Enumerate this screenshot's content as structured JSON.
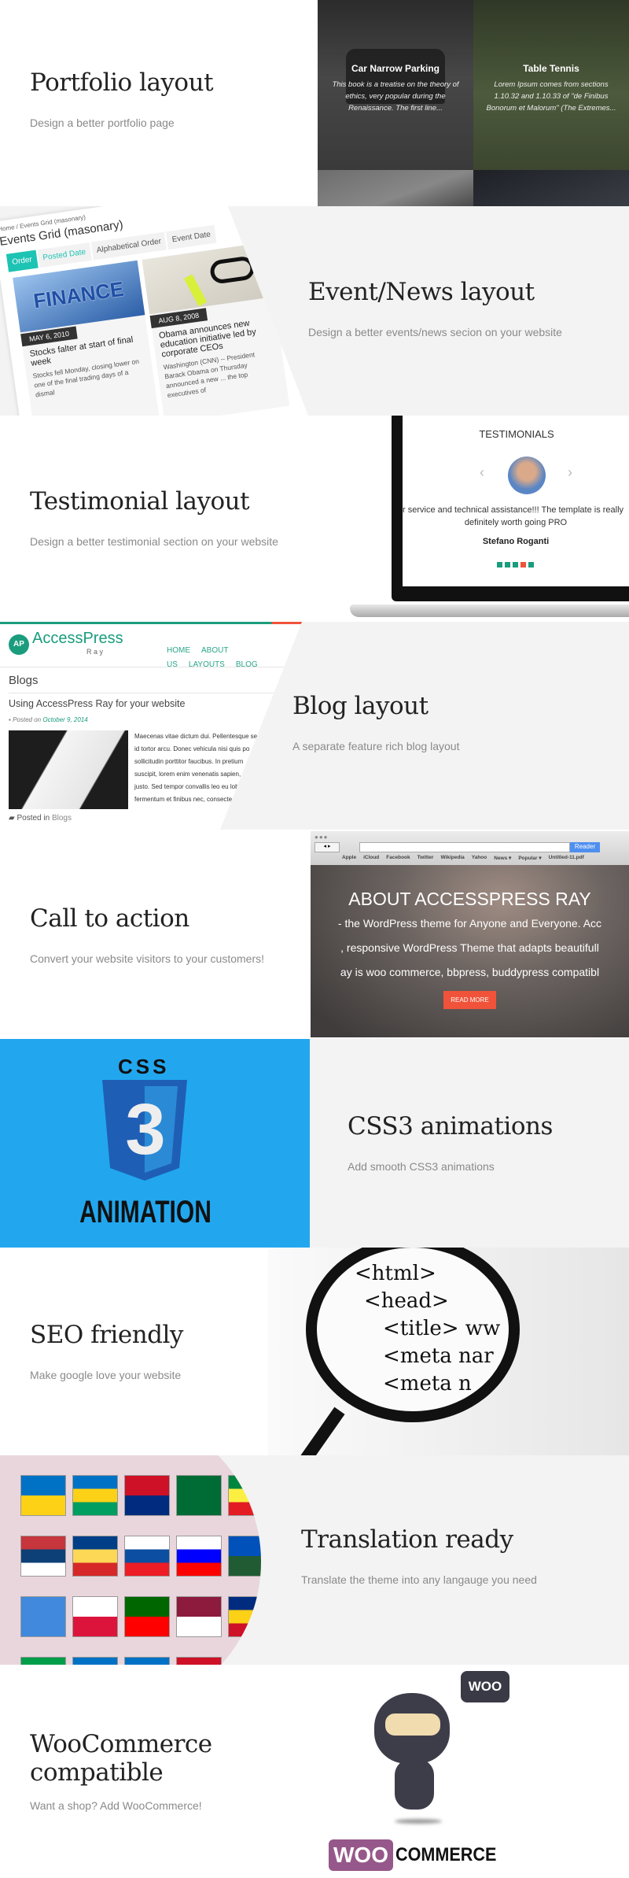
{
  "features": [
    {
      "title": "Portfolio layout",
      "subtitle": "Design a better portfolio page"
    },
    {
      "title": "Event/News layout",
      "subtitle": "Design a better events/news secion on your website"
    },
    {
      "title": "Testimonial layout",
      "subtitle": "Design a better testimonial section on your website"
    },
    {
      "title": "Blog layout",
      "subtitle": "A separate feature rich blog layout"
    },
    {
      "title": "Call to action",
      "subtitle": "Convert your website visitors to your customers!"
    },
    {
      "title": "CSS3 animations",
      "subtitle": "Add smooth CSS3 animations"
    },
    {
      "title": "SEO friendly",
      "subtitle": "Make google love your website"
    },
    {
      "title": "Translation ready",
      "subtitle": "Translate the theme into any langauge you need"
    },
    {
      "title": "WooCommerce compatible",
      "subtitle": "Want a shop? Add WooCommerce!"
    }
  ],
  "portfolio": {
    "items": [
      {
        "title": "Car Narrow Parking",
        "text": "This book is a treatise on the theory of ethics, very popular during the Renaissance. The first line..."
      },
      {
        "title": "Table Tennis",
        "text": "Lorem Ipsum comes from sections 1.10.32 and 1.10.33 of \"de Finibus Bonorum et Malorum\" (The Extremes..."
      }
    ]
  },
  "events": {
    "breadcrumb": "Home / Events Grid (masonary)",
    "heading": "Events Grid (masonary)",
    "tabs": [
      "Order",
      "Posted Date",
      "Alphabetical Order",
      "Event Date"
    ],
    "cards": [
      {
        "image_text": "FINANCE",
        "date": "MAY 6, 2010",
        "title": "Stocks falter at start of final week",
        "text": "Stocks fell Monday, closing lower on one of the final trading days of a dismal"
      },
      {
        "date": "AUG 8, 2008",
        "title": "Obama announces new education initiative led by corporate CEOs",
        "text": "Washington (CNN) -- President Barack Obama on Thursday announced a new ... the top executives of"
      }
    ]
  },
  "testimonial": {
    "heading": "TESTIMONIALS",
    "quote_line1": "r service and technical assistance!!! The template is really",
    "quote_line2": "definitely worth going PRO",
    "name": "Stefano Roganti",
    "dots": 5,
    "active_dot": 4,
    "colors": {
      "dot": "#1a9c7d",
      "active": "#f0533a"
    }
  },
  "blog": {
    "logo_badge": "AP",
    "logo_text": "AccessPress",
    "logo_sub": "R a y",
    "nav": [
      "HOME",
      "ABOUT US",
      "LAYOUTS",
      "BLOG"
    ],
    "page_heading": "Blogs",
    "post_title": "Using AccessPress Ray for your website",
    "posted_on": "Posted on",
    "date": "October 9, 2014",
    "excerpt": [
      "Maecenas vitae dictum dui. Pellentesque se",
      "id tortor arcu. Donec vehicula nisi quis po",
      "sollicitudin porttitor faucibus. In pretium",
      "suscipit, lorem enim venenatis sapien,",
      "justo. Sed tempor convallis leo eu lob",
      "fermentum et finibus nec, consecte"
    ],
    "posted_in": "Posted in",
    "category": "Blogs"
  },
  "cta": {
    "bookmarks": [
      "Apple",
      "iCloud",
      "Facebook",
      "Twitter",
      "Wikipedia",
      "Yahoo",
      "News ▾",
      "Popular ▾",
      "Untitled-11.pdf"
    ],
    "reader": "Reader",
    "heading": "ABOUT ACCESSPRESS RAY",
    "lines": [
      "- the WordPress theme for Anyone and Everyone. Acc",
      ", responsive WordPress Theme that adapts beautifull",
      "ay is woo commerce, bbpress, buddypress compatibl"
    ],
    "button": "READ MORE"
  },
  "css3": {
    "top": "CSS",
    "number": "3",
    "bottom": "ANIMATION",
    "bg": "#22a7ef"
  },
  "seo": {
    "code": [
      "<html>",
      "<head>",
      "<title> ww",
      "<meta nar",
      "<meta n"
    ]
  },
  "woo": {
    "bubble": "WOO",
    "logo_left": "WOO",
    "logo_right": "COMMERCE",
    "brand": "#96588a"
  }
}
